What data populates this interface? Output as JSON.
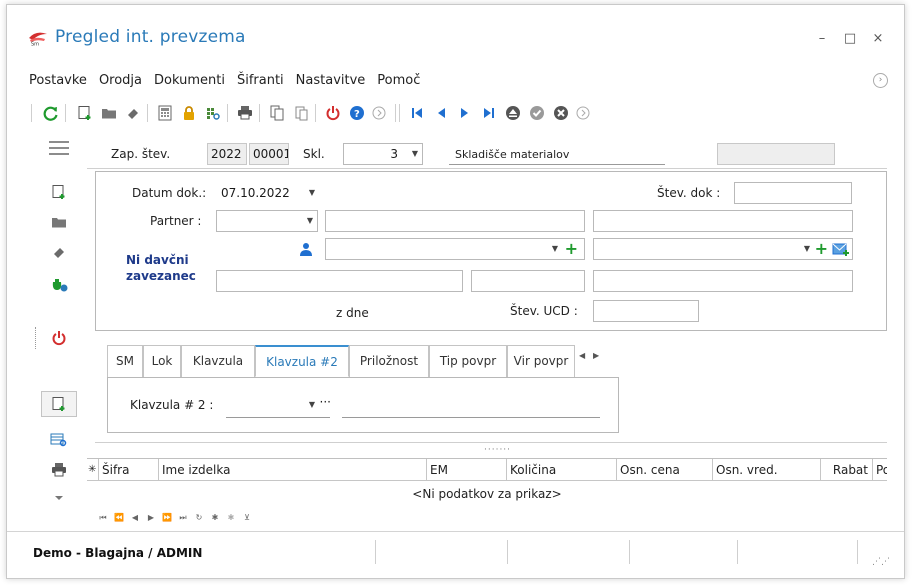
{
  "window": {
    "title": "Pregled int. prevzema",
    "controls": {
      "minimize": "–",
      "maximize": "□",
      "close": "×"
    }
  },
  "menu": [
    "Postavke",
    "Orodja",
    "Dokumenti",
    "Šifranti",
    "Nastavitve",
    "Pomoč"
  ],
  "menu_extra_icon": "chevron-circle-icon",
  "colors": {
    "accent": "#2a7ab8",
    "green": "#1f9a2e",
    "red": "#d32f2f",
    "gold": "#e3a300",
    "nav_blue": "#1f6fd0"
  },
  "header": {
    "zap_label": "Zap. štev.",
    "zap_year": "2022",
    "zap_num": "00001",
    "skl_label": "Skl.",
    "skl_value": "3",
    "skl_name": "Skladišče materialov",
    "extra_value": ""
  },
  "form": {
    "datum_label": "Datum dok.:",
    "datum_value": "07.10.2022",
    "partner_label": "Partner :",
    "partner_value": "",
    "partner_name": "",
    "partner_extra": "",
    "stev_dok_label": "Štev. dok :",
    "stev_dok_value": "",
    "contact1_value": "",
    "contact2_value": "",
    "tax_status": "Ni davčni zavezanec",
    "addr1": "",
    "addr2": "",
    "addr3": "",
    "z_dne_label": "z dne",
    "stev_ucd_label": "Štev. UCD :",
    "stev_ucd_value": ""
  },
  "tabs": [
    {
      "label": "SM",
      "active": false
    },
    {
      "label": "Lok",
      "active": false
    },
    {
      "label": "Klavzula",
      "active": false
    },
    {
      "label": "Klavzula #2",
      "active": true
    },
    {
      "label": "Priložnost",
      "active": false
    },
    {
      "label": "Tip povpr",
      "active": false
    },
    {
      "label": "Vir povpr",
      "active": false
    }
  ],
  "tab_content": {
    "klavzula2_label": "Klavzula # 2 :",
    "klavzula2_value": "",
    "klavzula2_text": ""
  },
  "grid": {
    "columns": [
      "Šifra",
      "Ime izdelka",
      "EM",
      "Količina",
      "Osn. cena",
      "Osn. vred.",
      "Rabat",
      "Po"
    ],
    "empty_text": "<Ni podatkov za prikaz>"
  },
  "status": {
    "text": "Demo - Blagajna / ADMIN"
  }
}
